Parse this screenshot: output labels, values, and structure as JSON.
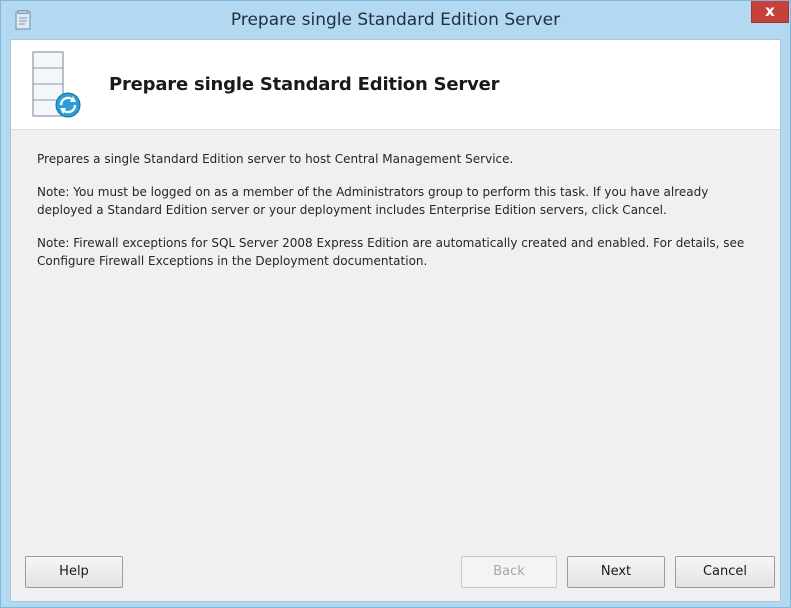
{
  "window": {
    "title": "Prepare single Standard Edition Server",
    "close_label": "x"
  },
  "header": {
    "title": "Prepare single Standard Edition Server"
  },
  "content": {
    "paragraphs": [
      "Prepares a single Standard Edition server to host Central Management Service.",
      "Note: You must be logged on as a member of the Administrators group to perform this task. If you have already deployed a Standard Edition server or your deployment includes Enterprise Edition servers, click Cancel.",
      "Note: Firewall exceptions for SQL Server 2008 Express Edition are automatically created and enabled. For details, see Configure Firewall Exceptions in the Deployment documentation."
    ]
  },
  "buttons": {
    "help": "Help",
    "back": "Back",
    "next": "Next",
    "cancel": "Cancel"
  },
  "icons": {
    "app": "setup-icon",
    "header": "server-refresh-icon"
  },
  "colors": {
    "title_bar": "#b3d9f1",
    "close_button": "#c7413a",
    "dialog_background": "#f0f0f0",
    "header_background": "#ffffff"
  }
}
